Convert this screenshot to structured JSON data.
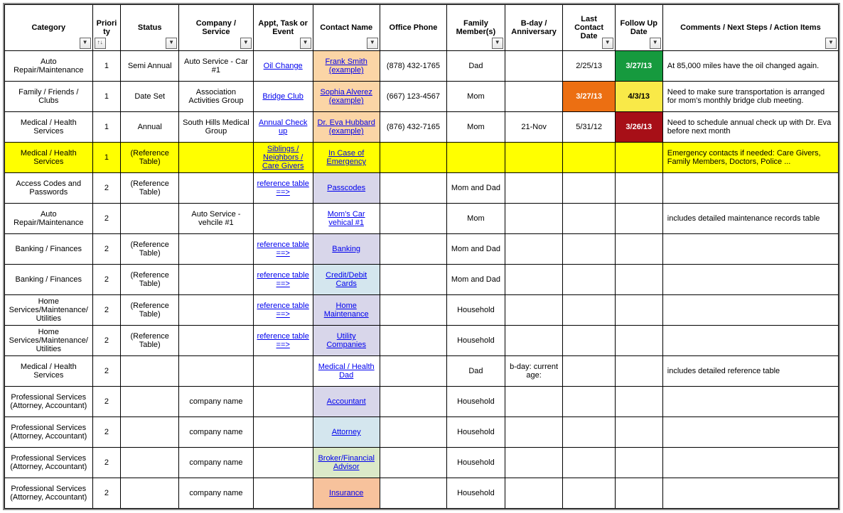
{
  "headers": {
    "c0": "Category",
    "c1": "Priority",
    "c2": "Status",
    "c3": "Company / Service",
    "c4": "Appt, Task or Event",
    "c5": "Contact Name",
    "c6": "Office Phone",
    "c7": "Family Member(s)",
    "c8": "B-day / Anniversary",
    "c9": "Last Contact Date",
    "c10": "Follow Up Date",
    "c11": "Comments / Next Steps / Action Items"
  },
  "rows": [
    {
      "category": "Auto Repair/Maintenance",
      "priority": "1",
      "status": "Semi Annual",
      "company": "Auto Service - Car #1",
      "appt": "Oil Change",
      "contact": "Frank Smith (example)",
      "phone": "(878) 432-1765",
      "family": "Dad",
      "bday": "",
      "lastContact": "2/25/13",
      "followUp": "3/27/13",
      "comments": "At 85,000 miles have the oil changed again.",
      "contactBg": "bg-peach",
      "lastBg": "",
      "followBg": "bg-green",
      "apptLink": true,
      "contactLink": true,
      "rowClass": ""
    },
    {
      "category": "Family / Friends / Clubs",
      "priority": "1",
      "status": "Date Set",
      "company": "Association Activities Group",
      "appt": "Bridge Club",
      "contact": "Sophia Alverez (example)",
      "phone": "(667) 123-4567",
      "family": "Mom",
      "bday": "",
      "lastContact": "3/27/13",
      "followUp": "4/3/13",
      "comments": "Need to make sure transportation is arranged for mom's monthly bridge club meeting.",
      "contactBg": "bg-peach",
      "lastBg": "bg-orange",
      "followBg": "bg-yellowC",
      "apptLink": true,
      "contactLink": true,
      "rowClass": ""
    },
    {
      "category": "Medical / Health Services",
      "priority": "1",
      "status": "Annual",
      "company": "South Hills Medical Group",
      "appt": "Annual Check up",
      "contact": "Dr. Eva Hubbard (example)",
      "phone": "(876) 432-7165",
      "family": "Mom",
      "bday": "21-Nov",
      "lastContact": "5/31/12",
      "followUp": "3/26/13",
      "comments": "Need to schedule annual check up with Dr. Eva before next month",
      "contactBg": "bg-peach",
      "lastBg": "",
      "followBg": "bg-darkred",
      "apptLink": true,
      "contactLink": true,
      "rowClass": ""
    },
    {
      "category": "Medical / Health Services",
      "priority": "1",
      "status": "(Reference Table)",
      "company": "",
      "appt": "Siblings / Neighbors / Care Givers",
      "contact": "In Case of Emergency ",
      "phone": "",
      "family": "",
      "bday": "",
      "lastContact": "",
      "followUp": "",
      "comments": "Emergency contacts if needed: Care Givers, Family Members, Doctors, Police ...",
      "contactBg": "",
      "lastBg": "",
      "followBg": "",
      "apptLink": true,
      "contactLink": true,
      "rowClass": "row-yellow"
    },
    {
      "category": "Access Codes and Passwords",
      "priority": "2",
      "status": "(Reference Table)",
      "company": "",
      "appt": "reference table ==>",
      "contact": "Passcodes ",
      "phone": "",
      "family": "Mom and Dad",
      "bday": "",
      "lastContact": "",
      "followUp": "",
      "comments": "",
      "contactBg": "bg-lavender",
      "lastBg": "",
      "followBg": "",
      "apptLink": true,
      "contactLink": true,
      "rowClass": ""
    },
    {
      "category": "Auto Repair/Maintenance",
      "priority": "2",
      "status": "",
      "company": "Auto Service - vehcile #1",
      "appt": "",
      "contact": "Mom's Car vehical #1",
      "phone": "",
      "family": "Mom",
      "bday": "",
      "lastContact": "",
      "followUp": "",
      "comments": "includes detailed maintenance records table",
      "contactBg": "",
      "lastBg": "",
      "followBg": "",
      "apptLink": false,
      "contactLink": true,
      "rowClass": ""
    },
    {
      "category": "Banking / Finances",
      "priority": "2",
      "status": "(Reference Table)",
      "company": "",
      "appt": "reference table ==>",
      "contact": "Banking ",
      "phone": "",
      "family": "Mom and Dad",
      "bday": "",
      "lastContact": "",
      "followUp": "",
      "comments": "",
      "contactBg": "bg-lavender",
      "lastBg": "",
      "followBg": "",
      "apptLink": true,
      "contactLink": true,
      "rowClass": ""
    },
    {
      "category": "Banking / Finances",
      "priority": "2",
      "status": "(Reference Table)",
      "company": "",
      "appt": "reference table ==>",
      "contact": "Credit/Debit Cards ",
      "phone": "",
      "family": "Mom and Dad",
      "bday": "",
      "lastContact": "",
      "followUp": "",
      "comments": "",
      "contactBg": "bg-lightblue",
      "lastBg": "",
      "followBg": "",
      "apptLink": true,
      "contactLink": true,
      "rowClass": ""
    },
    {
      "category": "Home Services/Maintenance/Utilities",
      "priority": "2",
      "status": "(Reference Table)",
      "company": "",
      "appt": "reference table ==>",
      "contact": "Home Maintenance ",
      "phone": "",
      "family": "Household",
      "bday": "",
      "lastContact": "",
      "followUp": "",
      "comments": "",
      "contactBg": "bg-lavender",
      "lastBg": "",
      "followBg": "",
      "apptLink": true,
      "contactLink": true,
      "rowClass": ""
    },
    {
      "category": "Home Services/Maintenance/Utilities",
      "priority": "2",
      "status": "(Reference Table)",
      "company": "",
      "appt": "reference table ==>",
      "contact": "Utility Companies ",
      "phone": "",
      "family": "Household",
      "bday": "",
      "lastContact": "",
      "followUp": "",
      "comments": "",
      "contactBg": "bg-lavender",
      "lastBg": "",
      "followBg": "",
      "apptLink": true,
      "contactLink": true,
      "rowClass": ""
    },
    {
      "category": "Medical / Health Services",
      "priority": "2",
      "status": "",
      "company": "",
      "appt": "",
      "contact": "Medical / Health Dad",
      "phone": "",
      "family": "Dad",
      "bday": "b-day:      current age:",
      "lastContact": "",
      "followUp": "",
      "comments": "includes detailed reference table",
      "contactBg": "",
      "lastBg": "",
      "followBg": "",
      "apptLink": false,
      "contactLink": true,
      "rowClass": ""
    },
    {
      "category": "Professional Services (Attorney, Accountant)",
      "priority": "2",
      "status": "",
      "company": "company name",
      "appt": "",
      "contact": "Accountant ",
      "phone": "",
      "family": "Household",
      "bday": "",
      "lastContact": "",
      "followUp": "",
      "comments": "",
      "contactBg": "bg-lavender",
      "lastBg": "",
      "followBg": "",
      "apptLink": false,
      "contactLink": true,
      "rowClass": ""
    },
    {
      "category": "Professional Services (Attorney, Accountant)",
      "priority": "2",
      "status": "",
      "company": "company name",
      "appt": "",
      "contact": "Attorney ",
      "phone": "",
      "family": "Household",
      "bday": "",
      "lastContact": "",
      "followUp": "",
      "comments": "",
      "contactBg": "bg-lightblue",
      "lastBg": "",
      "followBg": "",
      "apptLink": false,
      "contactLink": true,
      "rowClass": ""
    },
    {
      "category": "Professional Services (Attorney, Accountant)",
      "priority": "2",
      "status": "",
      "company": "company name",
      "appt": "",
      "contact": "Broker/Financial Advisor ",
      "phone": "",
      "family": "Household",
      "bday": "",
      "lastContact": "",
      "followUp": "",
      "comments": "",
      "contactBg": "bg-lightgreen",
      "lastBg": "",
      "followBg": "",
      "apptLink": false,
      "contactLink": true,
      "rowClass": ""
    },
    {
      "category": "Professional Services (Attorney, Accountant)",
      "priority": "2",
      "status": "",
      "company": "company name",
      "appt": "",
      "contact": "Insurance ",
      "phone": "",
      "family": "Household",
      "bday": "",
      "lastContact": "",
      "followUp": "",
      "comments": "",
      "contactBg": "bg-salmon",
      "lastBg": "",
      "followBg": "",
      "apptLink": false,
      "contactLink": true,
      "rowClass": ""
    }
  ],
  "colWidths": [
    "118",
    "38",
    "78",
    "100",
    "80",
    "90",
    "90",
    "78",
    "78",
    "70",
    "64",
    "236"
  ]
}
